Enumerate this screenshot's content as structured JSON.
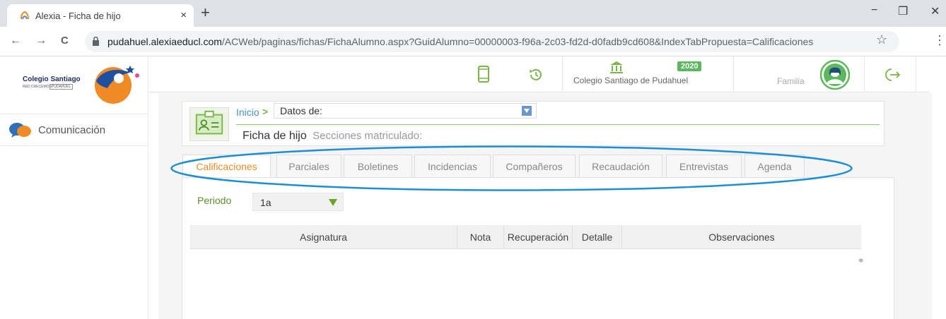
{
  "browser": {
    "tab_title": "Alexia - Ficha de hijo",
    "tab_close": "×",
    "new_tab": "+",
    "url_host": "pudahuel.alexiaeducl.com",
    "url_path": "/ACWeb/paginas/fichas/FichaAlumno.aspx?GuidAlumno=00000003-f96a-2c03-fd2d-d0fadb9cd608&IndexTabPropuesta=Calificaciones",
    "win_min": "−",
    "win_max": "❐",
    "win_close": "✕",
    "back": "←",
    "forward": "→",
    "reload": "C",
    "star": "☆",
    "menu": "⋮"
  },
  "sidebar": {
    "logo_text": "Colegio Santiago",
    "logo_sub": "RED CRECEMOS",
    "logo_sub2": "PUDAHUEL",
    "items": [
      {
        "label": "Comunicación",
        "icon": "chat-bubbles-icon"
      }
    ]
  },
  "topbar": {
    "school": "Colegio Santiago de Pudahuel",
    "year": "2020",
    "role": "Familia"
  },
  "header": {
    "breadcrumb_home": "Inicio",
    "breadcrumb_arrow": ">",
    "select_label": "Datos de:",
    "title": "Ficha de hijo",
    "subtitle": "Secciones matriculado:"
  },
  "tabs": [
    {
      "label": "Calificaciones",
      "active": true
    },
    {
      "label": "Parciales"
    },
    {
      "label": "Boletines"
    },
    {
      "label": "Incidencias"
    },
    {
      "label": "Compañeros"
    },
    {
      "label": "Recaudación"
    },
    {
      "label": "Entrevistas"
    },
    {
      "label": "Agenda"
    }
  ],
  "periodo": {
    "label": "Periodo",
    "value": "1a"
  },
  "table": {
    "columns": [
      "Asignatura",
      "Nota",
      "Recuperación",
      "Detalle",
      "Observaciones"
    ],
    "sort_glyph": "≑"
  },
  "colors": {
    "accent": "#f08a24",
    "green": "#5cb85c",
    "oval": "#1a8fd6"
  }
}
